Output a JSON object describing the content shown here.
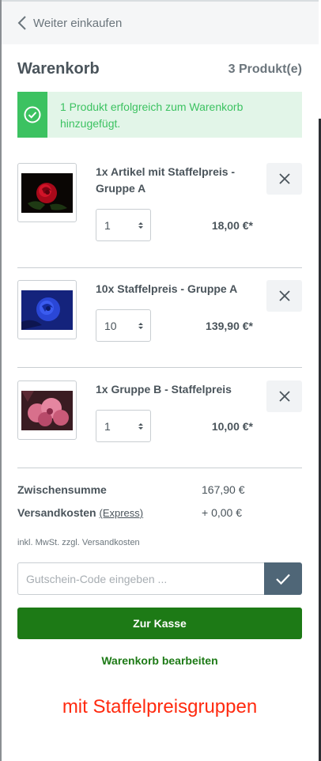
{
  "nav": {
    "back_label": "Weiter einkaufen"
  },
  "cart": {
    "title": "Warenkorb",
    "count": "3 Produkt(e)"
  },
  "alert": {
    "message": "1 Produkt erfolgreich zum Warenkorb hinzugefügt.",
    "color": "#3cc261"
  },
  "items": [
    {
      "name": "1x Artikel mit Staffelpreis - Gruppe A",
      "quantity": "1",
      "price": "18,00 €*",
      "image": "red-rose"
    },
    {
      "name": "10x Staffelpreis - Gruppe A",
      "quantity": "10",
      "price": "139,90 €*",
      "image": "blue-rose"
    },
    {
      "name": "1x Gruppe B - Staffelpreis",
      "quantity": "1",
      "price": "10,00 €*",
      "image": "pink-flower"
    }
  ],
  "summary": {
    "subtotal_label": "Zwischensumme",
    "subtotal_value": "167,90 €",
    "shipping_label": "Versandkosten",
    "shipping_method": "(Express)",
    "shipping_value": "+ 0,00 €",
    "vat_note": "inkl. MwSt. zzgl. Versandkosten"
  },
  "voucher": {
    "placeholder": "Gutschein-Code eingeben ..."
  },
  "actions": {
    "checkout_label": "Zur Kasse",
    "edit_label": "Warenkorb bearbeiten"
  },
  "annotation": "mit Staffelpreisgruppen",
  "colors": {
    "primary": "#1d7a16",
    "success": "#3cc261",
    "voucher_button": "#4f6677",
    "annotation": "#ff2a0f"
  }
}
